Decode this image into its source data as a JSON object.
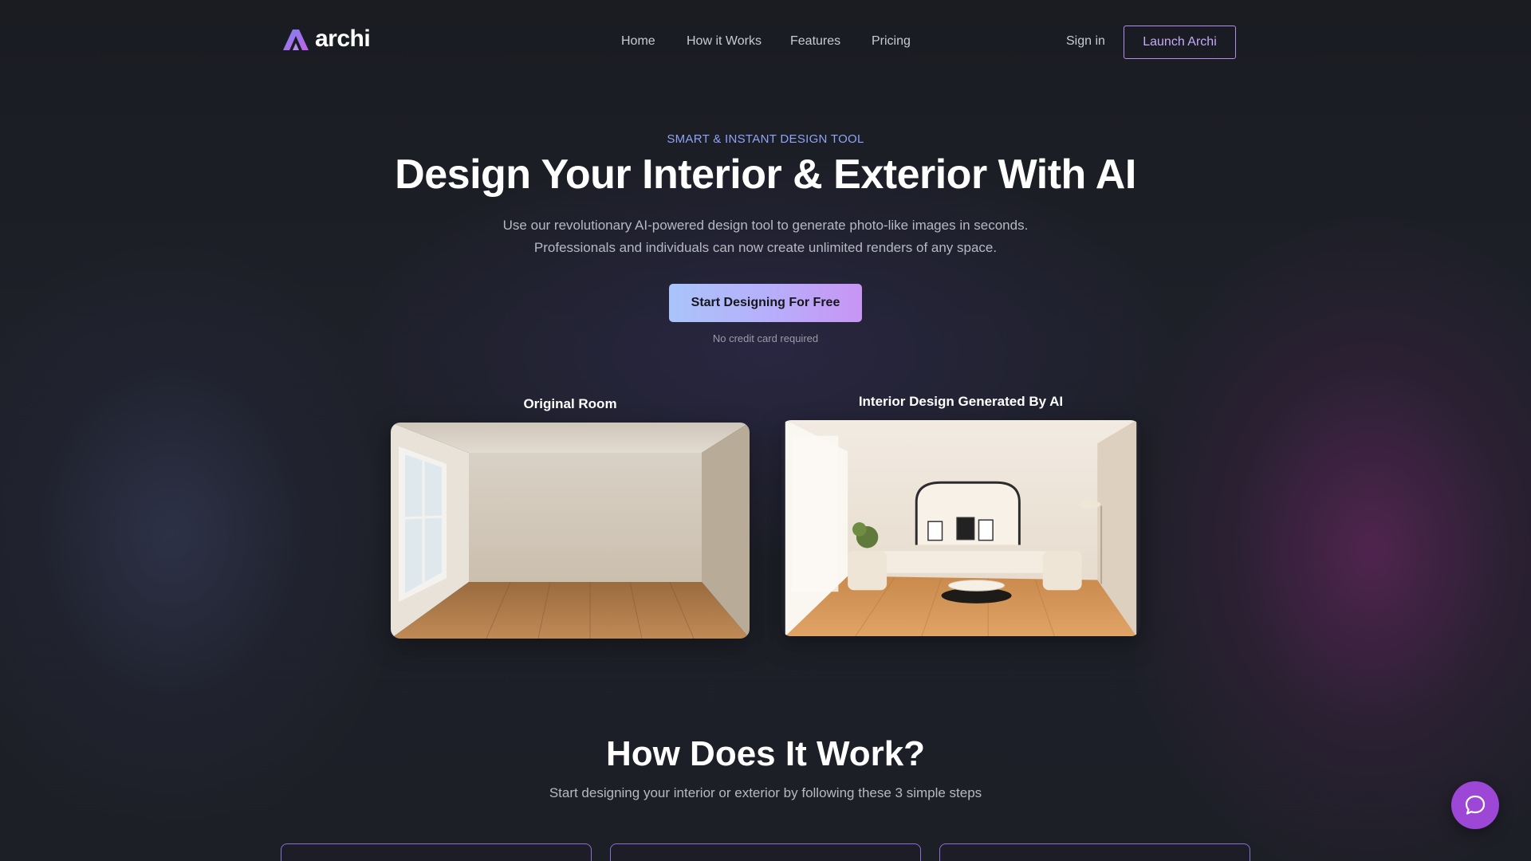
{
  "brand": {
    "name": "archi",
    "accent": "#b58cf2",
    "gradient_start": "#a9c4fa",
    "gradient_end": "#c895f3"
  },
  "nav": {
    "links": [
      "Home",
      "How it Works",
      "Features",
      "Pricing"
    ],
    "signin": "Sign in",
    "launch": "Launch Archi"
  },
  "hero": {
    "eyebrow": "SMART & INSTANT DESIGN TOOL",
    "headline": "Design Your Interior & Exterior With AI",
    "subtitle_line1": "Use our revolutionary AI-powered design tool to generate photo-like images in seconds.",
    "subtitle_line2": "Professionals and individuals can now create unlimited renders of any space.",
    "cta": "Start Designing For Free",
    "cta_note": "No credit card required"
  },
  "comparison": {
    "before_label": "Original Room",
    "after_label": "Interior Design Generated By AI"
  },
  "how": {
    "title": "How Does It Work?",
    "subtitle": "Start designing your interior or exterior by following these 3 simple steps"
  },
  "icons": {
    "logo": "archi-logo-icon",
    "chat": "chat-bubble-icon"
  }
}
